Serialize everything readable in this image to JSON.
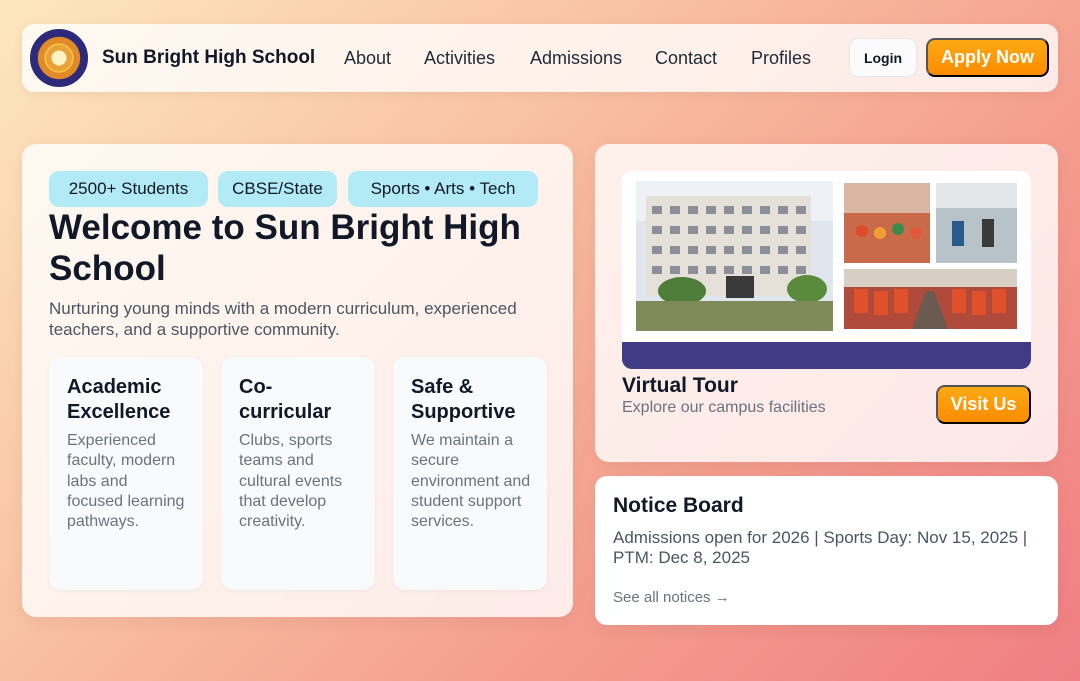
{
  "nav": {
    "brand": "Sun Bright High School",
    "links": [
      "About",
      "Activities",
      "Admissions",
      "Contact",
      "Profiles"
    ],
    "login": "Login",
    "apply": "Apply Now"
  },
  "hero": {
    "chips": [
      "2500+ Students",
      "CBSE/State",
      "Sports • Arts • Tech"
    ],
    "title": "Welcome to Sun Bright High School",
    "subtitle": "Nurturing young minds with a modern curriculum, experienced teachers, and a supportive community.",
    "features": [
      {
        "title": "Academic Excellence",
        "text": "Experienced faculty, modern labs and focused learning pathways."
      },
      {
        "title": "Co-curricular",
        "text": "Clubs, sports teams and cultural events that develop creativity."
      },
      {
        "title": "Safe & Supportive",
        "text": "We maintain a secure environment and student support services."
      }
    ]
  },
  "tour": {
    "title": "Virtual Tour",
    "subtitle": "Explore our campus facilities",
    "button": "Visit Us"
  },
  "notice": {
    "title": "Notice Board",
    "text": "Admissions open for 2026 | Sports Day: Nov 15, 2025 | PTM: Dec 8, 2025",
    "link": "See all notices →"
  },
  "colors": {
    "accent": "#fb8c00",
    "chip": "#b2ebf5",
    "banner": "#3f3b85"
  }
}
